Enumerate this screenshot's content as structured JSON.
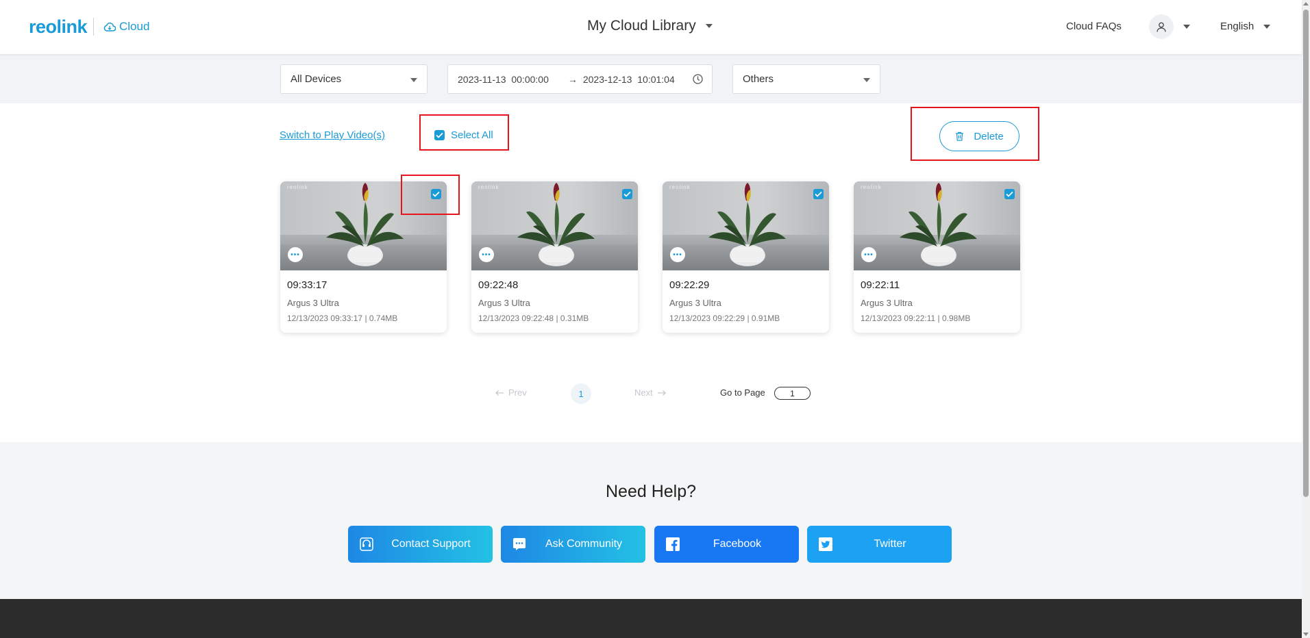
{
  "header": {
    "logo": "reolink",
    "cloud_label": "Cloud",
    "title": "My Cloud Library",
    "faq": "Cloud FAQs",
    "language": "English"
  },
  "filters": {
    "device": "All Devices",
    "start": "2023-11-13  00:00:00",
    "end": "2023-12-13  10:01:04",
    "type": "Others"
  },
  "actions": {
    "switch_link": "Switch to Play Video(s)",
    "select_all": "Select All",
    "select_all_checked": true,
    "delete": "Delete"
  },
  "clips": [
    {
      "time": "09:33:17",
      "device": "Argus 3 Ultra",
      "meta": "12/13/2023 09:33:17 | 0.74MB",
      "checked": true
    },
    {
      "time": "09:22:48",
      "device": "Argus 3 Ultra",
      "meta": "12/13/2023 09:22:48 | 0.31MB",
      "checked": true
    },
    {
      "time": "09:22:29",
      "device": "Argus 3 Ultra",
      "meta": "12/13/2023 09:22:29 | 0.91MB",
      "checked": true
    },
    {
      "time": "09:22:11",
      "device": "Argus 3 Ultra",
      "meta": "12/13/2023 09:22:11 | 0.98MB",
      "checked": true
    }
  ],
  "pagination": {
    "prev": "Prev",
    "current": "1",
    "next": "Next",
    "goto_label": "Go to Page",
    "goto_value": "1"
  },
  "help": {
    "title": "Need Help?",
    "buttons": [
      {
        "label": "Contact Support",
        "icon": "headset-icon"
      },
      {
        "label": "Ask Community",
        "icon": "chat-icon"
      },
      {
        "label": "Facebook",
        "icon": "facebook-icon"
      },
      {
        "label": "Twitter",
        "icon": "twitter-icon"
      }
    ]
  },
  "colors": {
    "accent": "#1a9ad6",
    "highlight": "#e8141b",
    "facebook": "#1877f2",
    "twitter": "#1da1f2"
  }
}
